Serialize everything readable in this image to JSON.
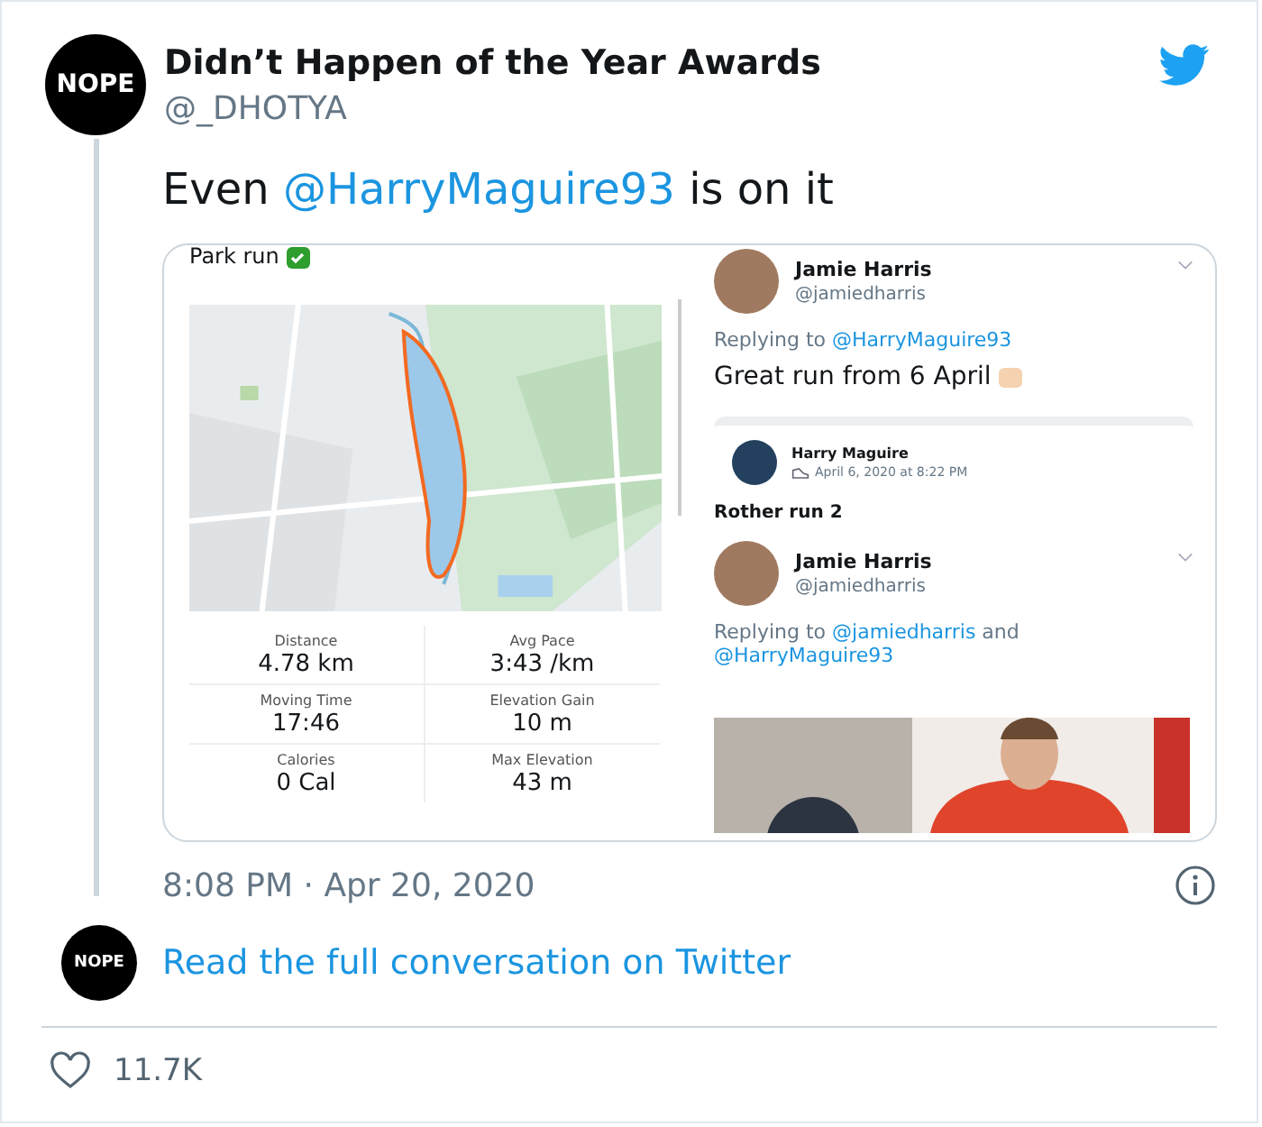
{
  "author": {
    "avatar_text": "NOPE",
    "name": "Didn’t Happen of the Year Awards",
    "handle": "@_DHOTYA"
  },
  "tweet_parts": [
    {
      "kind": "text",
      "text": "Even "
    },
    {
      "kind": "mention",
      "text": "@HarryMaguire93"
    },
    {
      "kind": "text",
      "text": " is on it"
    }
  ],
  "media": {
    "left": {
      "title": "Park run",
      "stats": [
        {
          "label": "Distance",
          "value": "4.78 km"
        },
        {
          "label": "Avg Pace",
          "value": "3:43 /km"
        },
        {
          "label": "Moving Time",
          "value": "17:46"
        },
        {
          "label": "Elevation Gain",
          "value": "10 m"
        },
        {
          "label": "Calories",
          "value": "0 Cal"
        },
        {
          "label": "Max Elevation",
          "value": "43 m"
        }
      ]
    },
    "right": {
      "reply1": {
        "name": "Jamie Harris",
        "handle": "@jamiedharris",
        "replying_prefix": "Replying to",
        "replying_to": [
          "@HarryMaguire93"
        ],
        "text": "Great run from 6 April"
      },
      "activity": {
        "name": "Harry Maguire",
        "date": "April 6, 2020 at 8:22 PM",
        "title": "Rother run 2"
      },
      "reply2": {
        "name": "Jamie Harris",
        "handle": "@jamiedharris",
        "replying_prefix": "Replying to",
        "replying_to": [
          "@jamiedharris",
          "@HarryMaguire93"
        ],
        "joiner": "and"
      }
    }
  },
  "timestamp": "8:08 PM · Apr 20, 2020",
  "conversation": {
    "avatar_text": "NOPE",
    "link": "Read the full conversation on Twitter"
  },
  "likes": "11.7K"
}
